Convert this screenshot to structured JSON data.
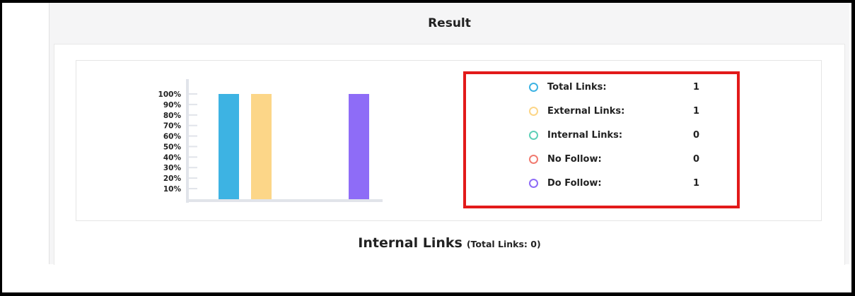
{
  "card": {
    "title": "Result"
  },
  "chart_data": {
    "type": "bar",
    "categories": [
      "Total Links",
      "External Links",
      "Internal Links",
      "No Follow",
      "Do Follow"
    ],
    "values": [
      100,
      100,
      0,
      0,
      100
    ],
    "colors": [
      "#3db3e3",
      "#fcd688",
      "#5ed0b8",
      "#f17b70",
      "#8e6cf7"
    ],
    "ytick_labels": [
      "100%",
      "90%",
      "80%",
      "70%",
      "60%",
      "50%",
      "40%",
      "30%",
      "20%",
      "10%"
    ],
    "ylim": [
      0,
      100
    ]
  },
  "legend": {
    "items": [
      {
        "label": "Total Links:",
        "value": "1",
        "color": "#3db3e3"
      },
      {
        "label": "External Links:",
        "value": "1",
        "color": "#fcd688"
      },
      {
        "label": "Internal Links:",
        "value": "0",
        "color": "#5ed0b8"
      },
      {
        "label": "No Follow:",
        "value": "0",
        "color": "#f17b70"
      },
      {
        "label": "Do Follow:",
        "value": "1",
        "color": "#8e6cf7"
      }
    ]
  },
  "internal_links": {
    "title": "Internal Links",
    "subtitle": "(Total Links: 0)"
  }
}
